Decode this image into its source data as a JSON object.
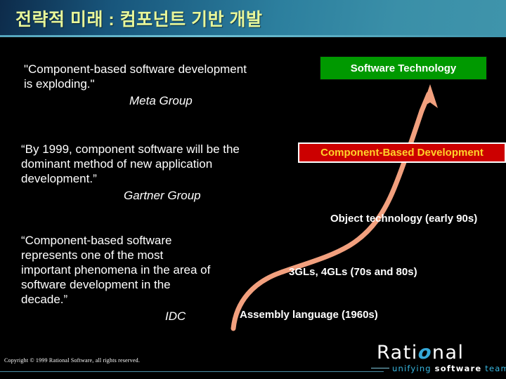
{
  "title_bar": {
    "title": "전략적 미래 : 컴포넌트 기반 개발",
    "title_color": "#e8f79a",
    "gradient_from": "#0d2b4a",
    "gradient_to": "#3f94ab"
  },
  "quotes": [
    {
      "text": "\"Component-based software development\nis exploding.\"",
      "source": "Meta Group"
    },
    {
      "text": "“By 1999, component software will be the\ndominant method of new application\ndevelopment.”",
      "source": "Gartner Group"
    },
    {
      "text": "“Component-based software\nrepresents one of the most\nimportant phenomena in the area of\nsoftware development in the\ndecade.”",
      "source": "IDC"
    }
  ],
  "boxes": {
    "software_technology": {
      "label": "Software Technology",
      "background": "#009900",
      "text_color": "#ffffff"
    },
    "component_based": {
      "label": "Component-Based Development",
      "background": "#cc0000",
      "text_color": "#ffd42a",
      "border_color": "#ffffff"
    }
  },
  "era_labels": [
    {
      "label": "Object technology (early 90s)"
    },
    {
      "label": "3GLs, 4GLs (70s and 80s)"
    },
    {
      "label": "Assembly language (1960s)"
    }
  ],
  "curve": {
    "name": "growth-s-curve",
    "color": "#f2a07e",
    "has_arrowhead": true
  },
  "footer": {
    "copyright": "Copyright © 1999 Rational Software, all rights reserved.",
    "logo": {
      "word_before": "Rati",
      "word_o": "o",
      "word_after": "nal",
      "tagline_1": "unifying",
      "tagline_2": "software",
      "tagline_3": "teams",
      "accent_color": "#35a8d8"
    }
  }
}
